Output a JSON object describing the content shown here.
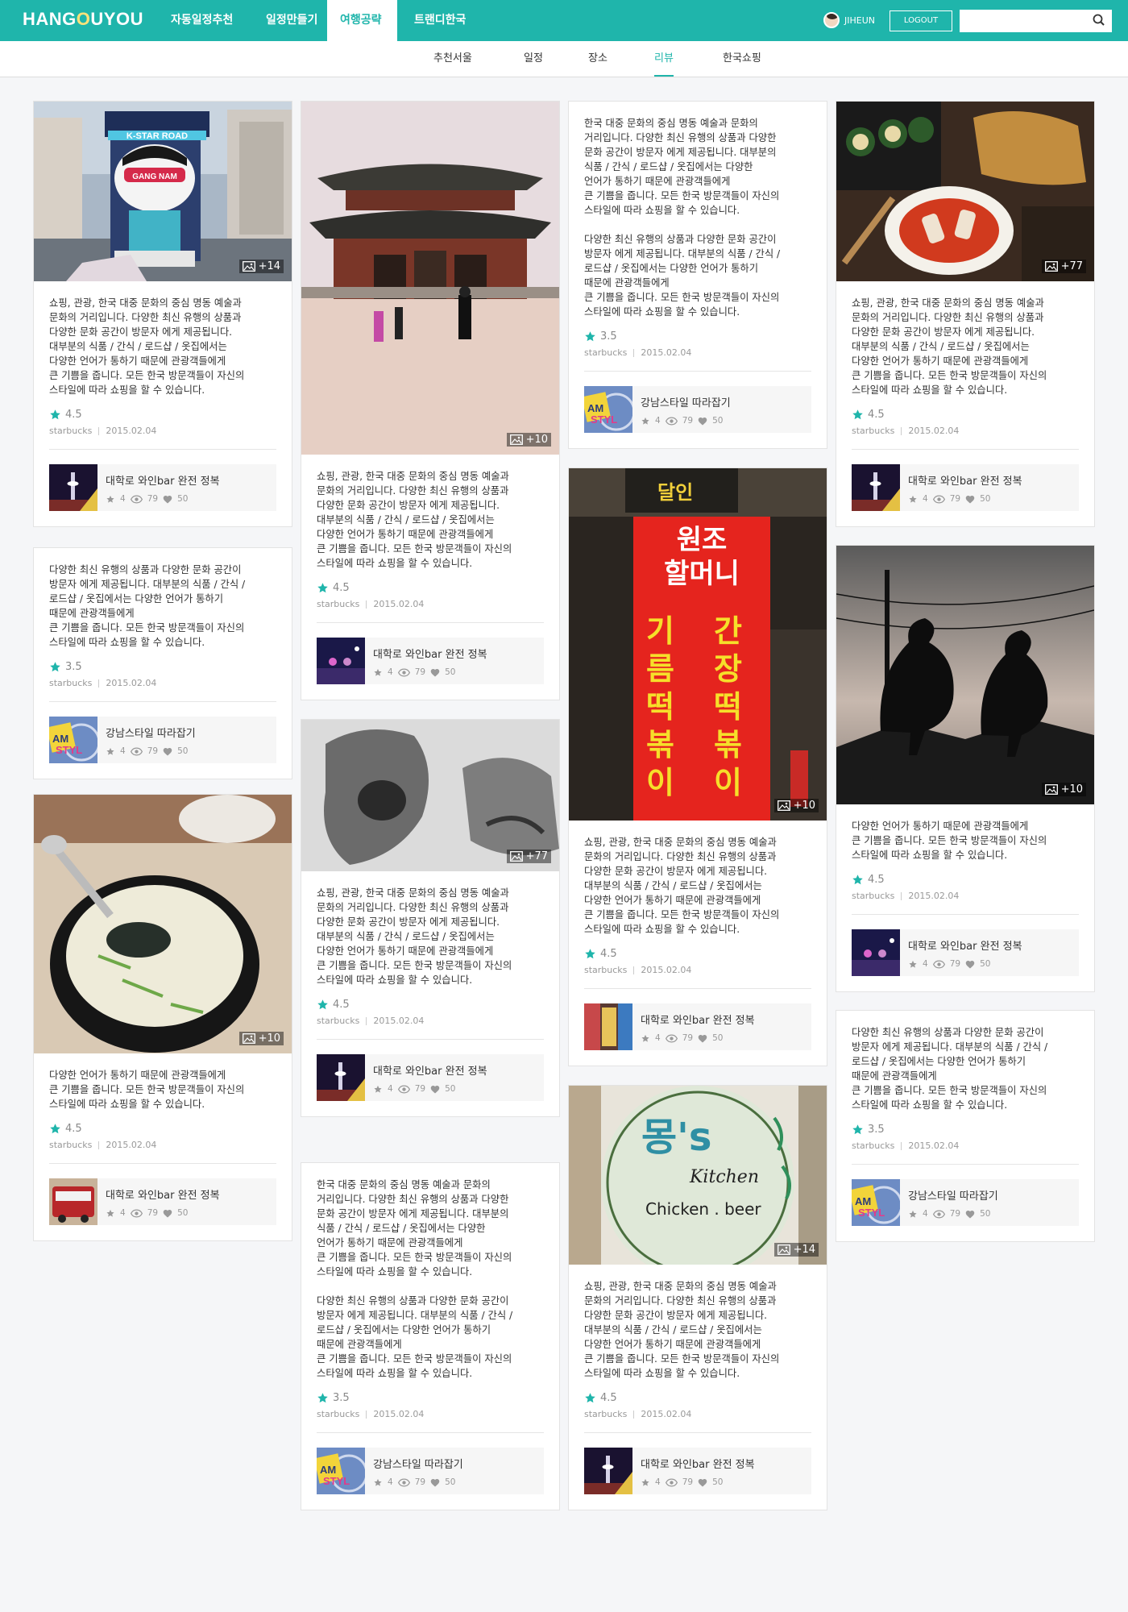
{
  "brand": {
    "logo_pre": "HANG",
    "logo_o": "O",
    "logo_post": "UYOU",
    "accent": "#1fb5ab"
  },
  "nav": {
    "items": [
      "자동일정추천",
      "일정만들기",
      "여행공략",
      "트랜디한국"
    ]
  },
  "user": {
    "name": "JIHEUN",
    "logout": "LOGOUT",
    "search_placeholder": ""
  },
  "subnav": {
    "items": [
      "추천서울",
      "일정",
      "장소",
      "리뷰",
      "한국쇼핑"
    ]
  },
  "cards": [
    {
      "photo_count": "+14",
      "desc": "쇼핑, 관광, 한국 대중 문화의 중심 명동 예술과\n문화의 거리입니다. 다양한 최신 유행의 상품과\n다양한 문화 공간이 방문자 에게 제공됩니다.\n대부분의 식품 / 간식 / 로드샵 / 옷집에서는\n다양한 언어가 통하기 때문에 관광객들에게\n큰 기쁨을 줍니다. 모든 한국 방문객들이 자신의\n스타일에 따라 쇼핑을 할 수 있습니다.",
      "rating": "4.5",
      "author": "starbucks",
      "date": "2015.02.04",
      "related": "대학로 와인bar 완전 정복",
      "r_stars": "4",
      "r_views": "79",
      "r_likes": "50"
    },
    {
      "photo_count": "",
      "desc": "다양한 최신 유행의 상품과 다양한 문화 공간이\n방문자 에게 제공됩니다. 대부분의 식품 / 간식 /\n로드샵 / 옷집에서는 다양한 언어가 통하기\n때문에 관광객들에게\n큰 기쁨을 줍니다. 모든 한국 방문객들이 자신의\n스타일에 따라 쇼핑을 할 수 있습니다.",
      "rating": "3.5",
      "author": "starbucks",
      "date": "2015.02.04",
      "related": "강남스타일 따라잡기",
      "r_stars": "4",
      "r_views": "79",
      "r_likes": "50"
    },
    {
      "photo_count": "+10",
      "desc": "다양한 언어가 통하기 때문에 관광객들에게\n큰 기쁨을 줍니다. 모든 한국 방문객들이 자신의\n스타일에 따라 쇼핑을 할 수 있습니다.",
      "rating": "4.5",
      "author": "starbucks",
      "date": "2015.02.04",
      "related": "대학로 와인bar 완전 정복",
      "r_stars": "4",
      "r_views": "79",
      "r_likes": "50"
    },
    {
      "photo_count": "+10",
      "desc": "쇼핑, 관광, 한국 대중 문화의 중심 명동 예술과\n문화의 거리입니다. 다양한 최신 유행의 상품과\n다양한 문화 공간이 방문자 에게 제공됩니다.\n대부분의 식품 / 간식 / 로드샵 / 옷집에서는\n다양한 언어가 통하기 때문에 관광객들에게\n큰 기쁨을 줍니다. 모든 한국 방문객들이 자신의\n스타일에 따라 쇼핑을 할 수 있습니다.",
      "rating": "4.5",
      "author": "starbucks",
      "date": "2015.02.04",
      "related": "대학로 와인bar 완전 정복",
      "r_stars": "4",
      "r_views": "79",
      "r_likes": "50"
    },
    {
      "photo_count": "+77",
      "desc": "쇼핑, 관광, 한국 대중 문화의 중심 명동 예술과\n문화의 거리입니다. 다양한 최신 유행의 상품과\n다양한 문화 공간이 방문자 에게 제공됩니다.\n대부분의 식품 / 간식 / 로드샵 / 옷집에서는\n다양한 언어가 통하기 때문에 관광객들에게\n큰 기쁨을 줍니다. 모든 한국 방문객들이 자신의\n스타일에 따라 쇼핑을 할 수 있습니다.",
      "rating": "4.5",
      "author": "starbucks",
      "date": "2015.02.04",
      "related": "대학로 와인bar 완전 정복",
      "r_stars": "4",
      "r_views": "79",
      "r_likes": "50"
    },
    {
      "photo_count": "",
      "desc": "한국 대중 문화의 중심 명동 예술과 문화의\n거리입니다. 다양한 최신 유행의 상품과 다양한\n문화 공간이 방문자 에게 제공됩니다. 대부분의\n식품 / 간식 / 로드샵 / 옷집에서는 다양한\n언어가 통하기 때문에 관광객들에게\n큰 기쁨을 줍니다. 모든 한국 방문객들이 자신의\n스타일에 따라 쇼핑을 할 수 있습니다.\n\n다양한 최신 유행의 상품과 다양한 문화 공간이\n방문자 에게 제공됩니다. 대부분의 식품 / 간식 /\n로드샵 / 옷집에서는 다양한 언어가 통하기\n때문에 관광객들에게\n큰 기쁨을 줍니다. 모든 한국 방문객들이 자신의\n스타일에 따라 쇼핑을 할 수 있습니다.",
      "rating": "3.5",
      "author": "starbucks",
      "date": "2015.02.04",
      "related": "강남스타일 따라잡기",
      "r_stars": "4",
      "r_views": "79",
      "r_likes": "50"
    },
    {
      "photo_count": "",
      "desc": "한국 대중 문화의 중심 명동 예술과 문화의\n거리입니다. 다양한 최신 유행의 상품과 다양한\n문화 공간이 방문자 에게 제공됩니다. 대부분의\n식품 / 간식 / 로드샵 / 옷집에서는 다양한\n언어가 통하기 때문에 관광객들에게\n큰 기쁨을 줍니다. 모든 한국 방문객들이 자신의\n스타일에 따라 쇼핑을 할 수 있습니다.\n\n다양한 최신 유행의 상품과 다양한 문화 공간이\n방문자 에게 제공됩니다. 대부분의 식품 / 간식 /\n로드샵 / 옷집에서는 다양한 언어가 통하기\n때문에 관광객들에게\n큰 기쁨을 줍니다. 모든 한국 방문객들이 자신의\n스타일에 따라 쇼핑을 할 수 있습니다.",
      "rating": "3.5",
      "author": "starbucks",
      "date": "2015.02.04",
      "related": "강남스타일 따라잡기",
      "r_stars": "4",
      "r_views": "79",
      "r_likes": "50"
    },
    {
      "photo_count": "+10",
      "desc": "쇼핑, 관광, 한국 대중 문화의 중심 명동 예술과\n문화의 거리입니다. 다양한 최신 유행의 상품과\n다양한 문화 공간이 방문자 에게 제공됩니다.\n대부분의 식품 / 간식 / 로드샵 / 옷집에서는\n다양한 언어가 통하기 때문에 관광객들에게\n큰 기쁨을 줍니다. 모든 한국 방문객들이 자신의\n스타일에 따라 쇼핑을 할 수 있습니다.",
      "rating": "4.5",
      "author": "starbucks",
      "date": "2015.02.04",
      "related": "대학로 와인bar 완전 정복",
      "r_stars": "4",
      "r_views": "79",
      "r_likes": "50"
    },
    {
      "photo_count": "+14",
      "desc": "쇼핑, 관광, 한국 대중 문화의 중심 명동 예술과\n문화의 거리입니다. 다양한 최신 유행의 상품과\n다양한 문화 공간이 방문자 에게 제공됩니다.\n대부분의 식품 / 간식 / 로드샵 / 옷집에서는\n다양한 언어가 통하기 때문에 관광객들에게\n큰 기쁨을 줍니다. 모든 한국 방문객들이 자신의\n스타일에 따라 쇼핑을 할 수 있습니다.",
      "rating": "4.5",
      "author": "starbucks",
      "date": "2015.02.04",
      "related": "대학로 와인bar 완전 정복",
      "r_stars": "4",
      "r_views": "79",
      "r_likes": "50"
    },
    {
      "photo_count": "+77",
      "desc": "쇼핑, 관광, 한국 대중 문화의 중심 명동 예술과\n문화의 거리입니다. 다양한 최신 유행의 상품과\n다양한 문화 공간이 방문자 에게 제공됩니다.\n대부분의 식품 / 간식 / 로드샵 / 옷집에서는\n다양한 언어가 통하기 때문에 관광객들에게\n큰 기쁨을 줍니다. 모든 한국 방문객들이 자신의\n스타일에 따라 쇼핑을 할 수 있습니다.",
      "rating": "4.5",
      "author": "starbucks",
      "date": "2015.02.04",
      "related": "대학로 와인bar 완전 정복",
      "r_stars": "4",
      "r_views": "79",
      "r_likes": "50"
    },
    {
      "photo_count": "+10",
      "desc": "다양한 언어가 통하기 때문에 관광객들에게\n큰 기쁨을 줍니다. 모든 한국 방문객들이 자신의\n스타일에 따라 쇼핑을 할 수 있습니다.",
      "rating": "4.5",
      "author": "starbucks",
      "date": "2015.02.04",
      "related": "대학로 와인bar 완전 정복",
      "r_stars": "4",
      "r_views": "79",
      "r_likes": "50"
    },
    {
      "photo_count": "",
      "desc": "다양한 최신 유행의 상품과 다양한 문화 공간이\n방문자 에게 제공됩니다. 대부분의 식품 / 간식 /\n로드샵 / 옷집에서는 다양한 언어가 통하기\n때문에 관광객들에게\n큰 기쁨을 줍니다. 모든 한국 방문객들이 자신의\n스타일에 따라 쇼핑을 할 수 있습니다.",
      "rating": "3.5",
      "author": "starbucks",
      "date": "2015.02.04",
      "related": "강남스타일 따라잡기",
      "r_stars": "4",
      "r_views": "79",
      "r_likes": "50"
    }
  ],
  "photo_text": {
    "kstar": "K-STAR ROAD",
    "gangnam": "GANG NAM",
    "dalin_sign": "달인",
    "sign_main": "원조\n할머니",
    "sign_col1": "간장\n떡볶이",
    "sign_col2": "기름\n떡볶이",
    "mong": "몽's",
    "kitchen": "Kitchen",
    "chicken": "Chicken . beer"
  }
}
